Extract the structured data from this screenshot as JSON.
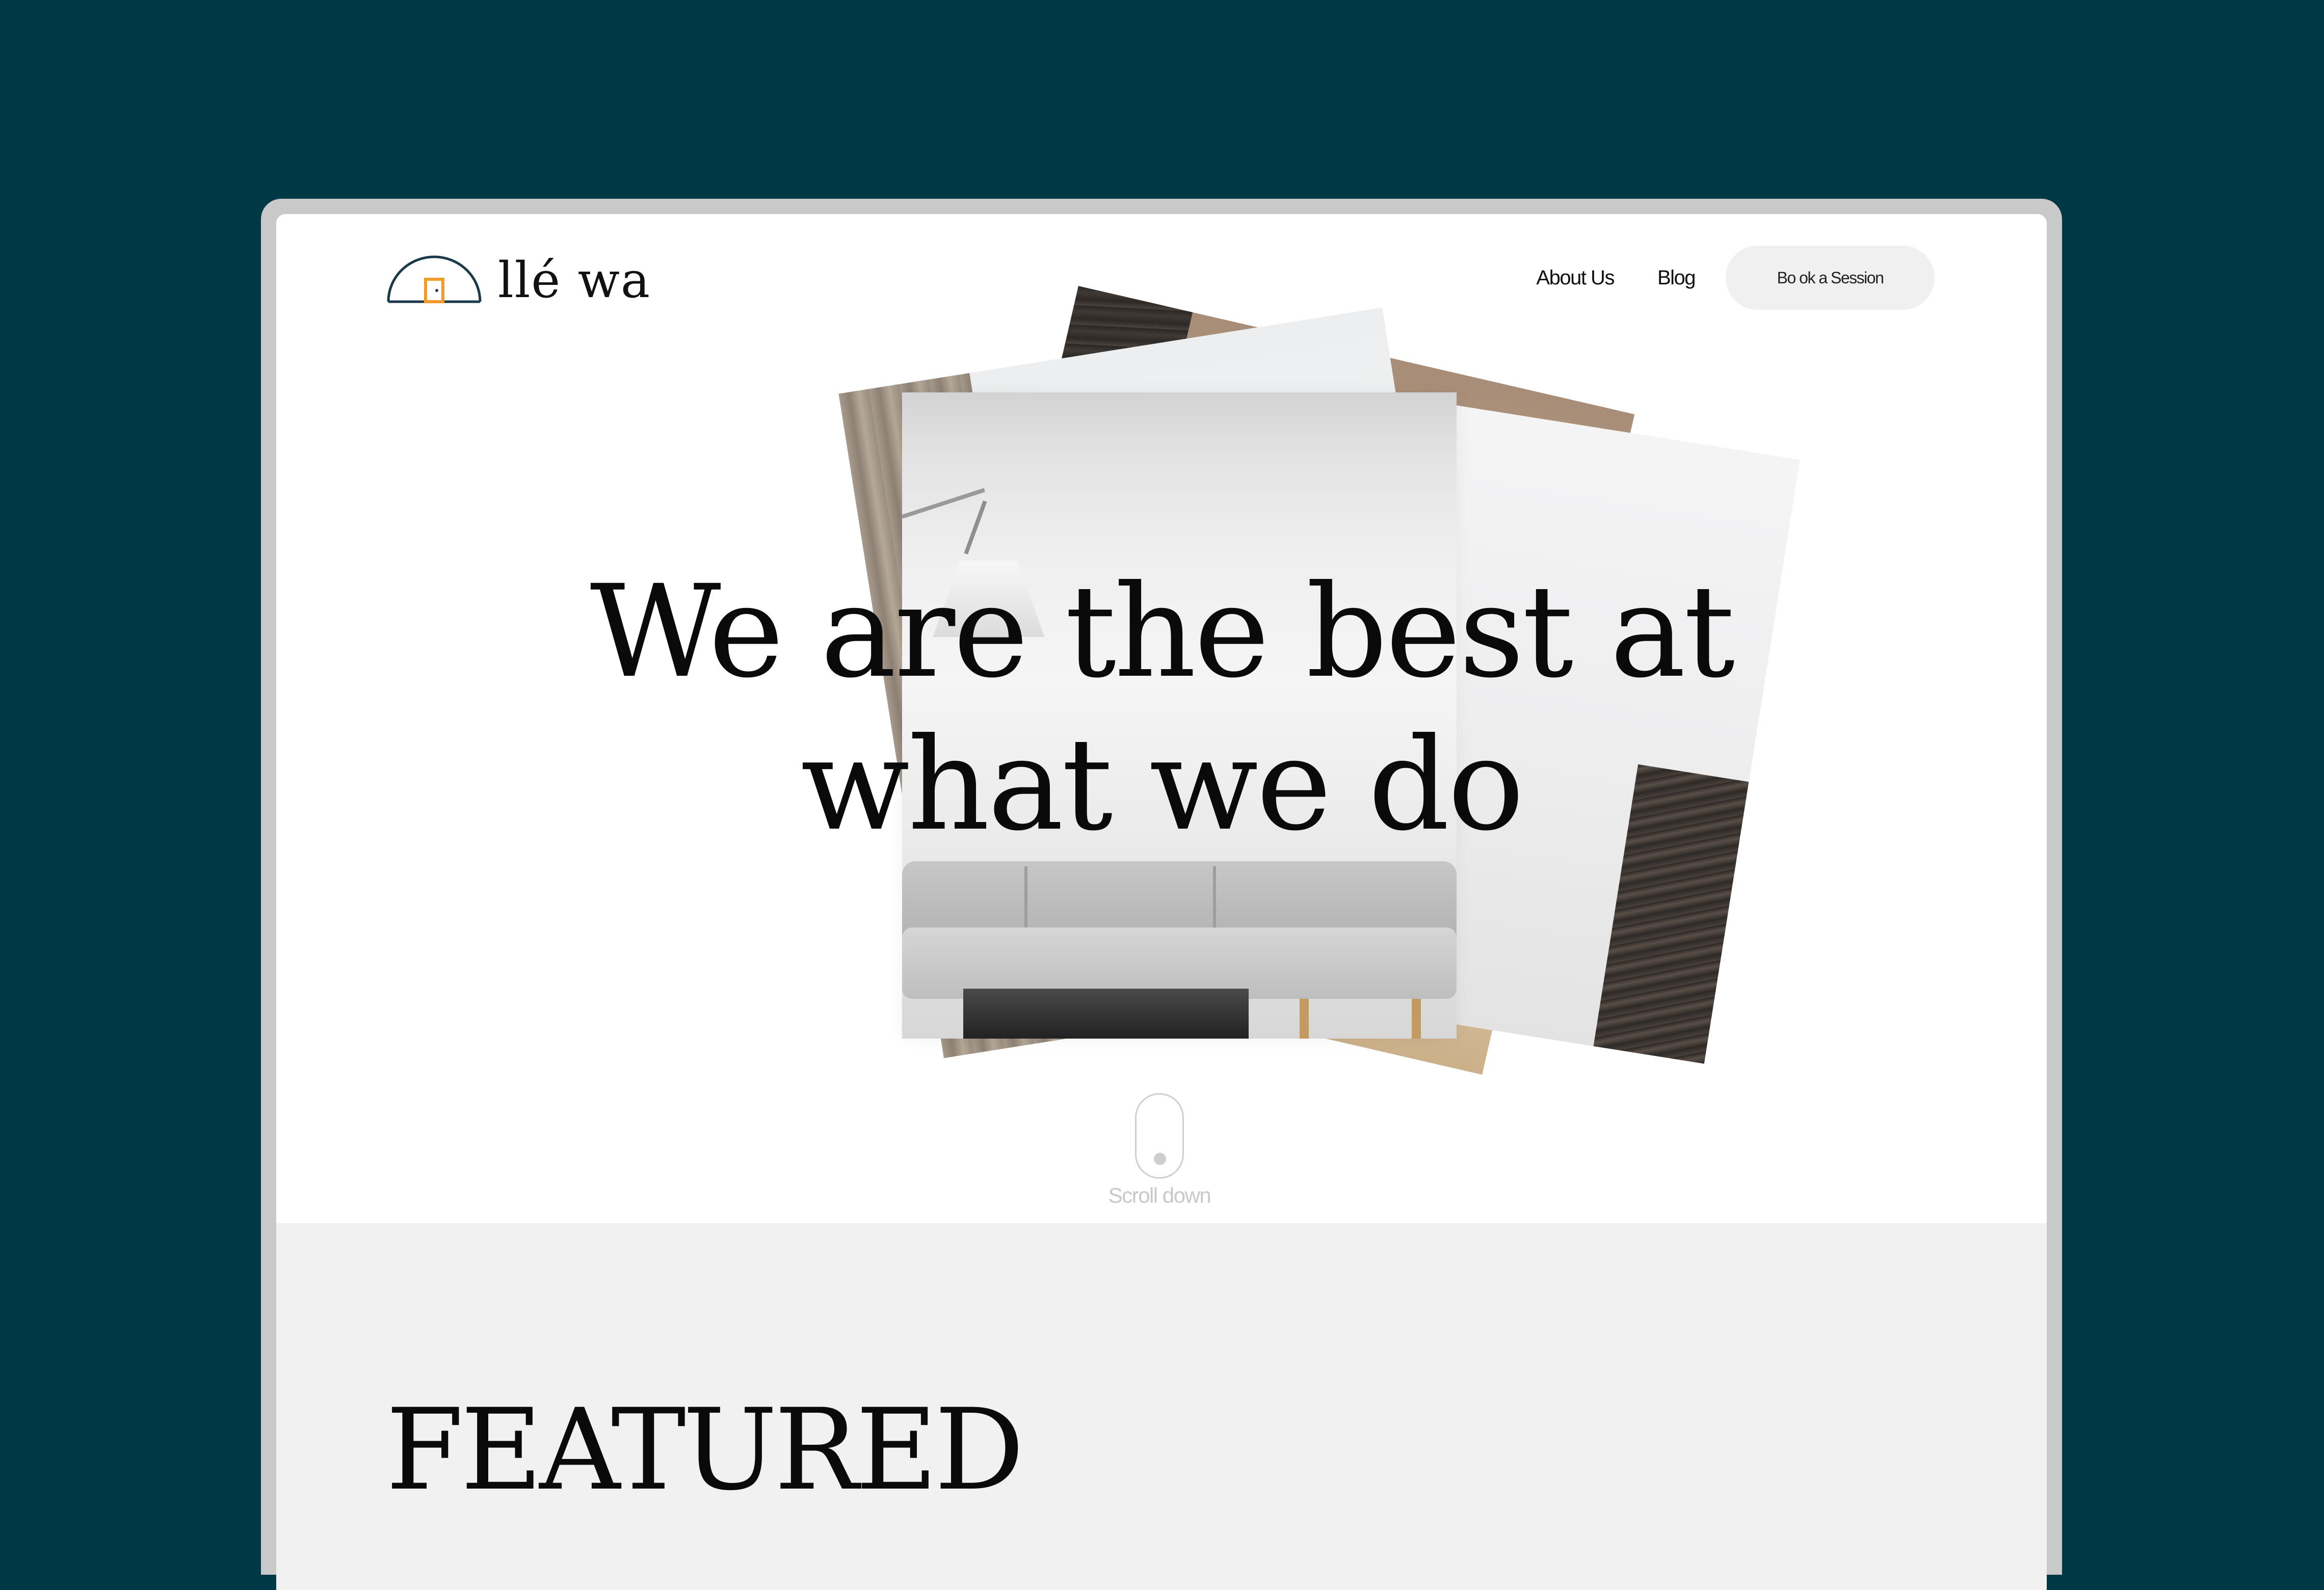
{
  "brand": {
    "name": "llé wa",
    "logo_icon": "dome-door-icon",
    "colors": {
      "background": "#003946",
      "logo_stroke": "#1a3a4a",
      "logo_door": "#f39a2a",
      "button_bg": "#f0f0f0",
      "featured_bg": "#f1f1f1"
    }
  },
  "nav": {
    "items": [
      {
        "label": "About Us"
      },
      {
        "label": "Blog"
      }
    ],
    "cta_label": "Bo ok a Session"
  },
  "hero": {
    "headline_line1": "We are the best at",
    "headline_line2": "what we do",
    "scroll_label": "Scroll down"
  },
  "featured": {
    "title": "FEATURED"
  }
}
